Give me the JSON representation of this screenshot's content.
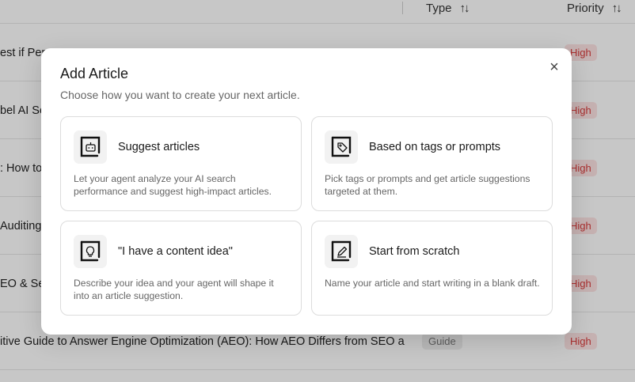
{
  "table": {
    "headers": {
      "type": "Type",
      "priority": "Priority"
    },
    "rows": [
      {
        "title": "est if Per",
        "type": "",
        "priority": "High"
      },
      {
        "title": "bel AI Se",
        "type": "",
        "priority": "High"
      },
      {
        "title": ": How to",
        "type": "",
        "priority": "High"
      },
      {
        "title": "Auditing",
        "type": "",
        "priority": "High"
      },
      {
        "title": "EO & Sea",
        "type": "",
        "priority": "High"
      },
      {
        "title": "itive Guide to Answer Engine Optimization (AEO): How AEO Differs from SEO a...",
        "type": "Guide",
        "priority": "High"
      }
    ]
  },
  "modal": {
    "title": "Add Article",
    "subtitle": "Choose how you want to create your next article.",
    "close_icon": "close-icon",
    "cards": [
      {
        "title": "Suggest articles",
        "description": "Let your agent analyze your AI search performance and suggest high-impact articles.",
        "icon": "robot-icon"
      },
      {
        "title": "Based on tags or prompts",
        "description": "Pick tags or prompts and get article suggestions targeted at them.",
        "icon": "tag-icon"
      },
      {
        "title": "\"I have a content idea\"",
        "description": "Describe your idea and your agent will shape it into an article suggestion.",
        "icon": "lightbulb-icon"
      },
      {
        "title": "Start from scratch",
        "description": "Name your article and start writing in a blank draft.",
        "icon": "pencil-icon"
      }
    ]
  },
  "colors": {
    "priority_high_text": "#d93b3b",
    "priority_high_bg": "#fde3e3",
    "overlay": "rgba(0,0,0,0.22)"
  }
}
